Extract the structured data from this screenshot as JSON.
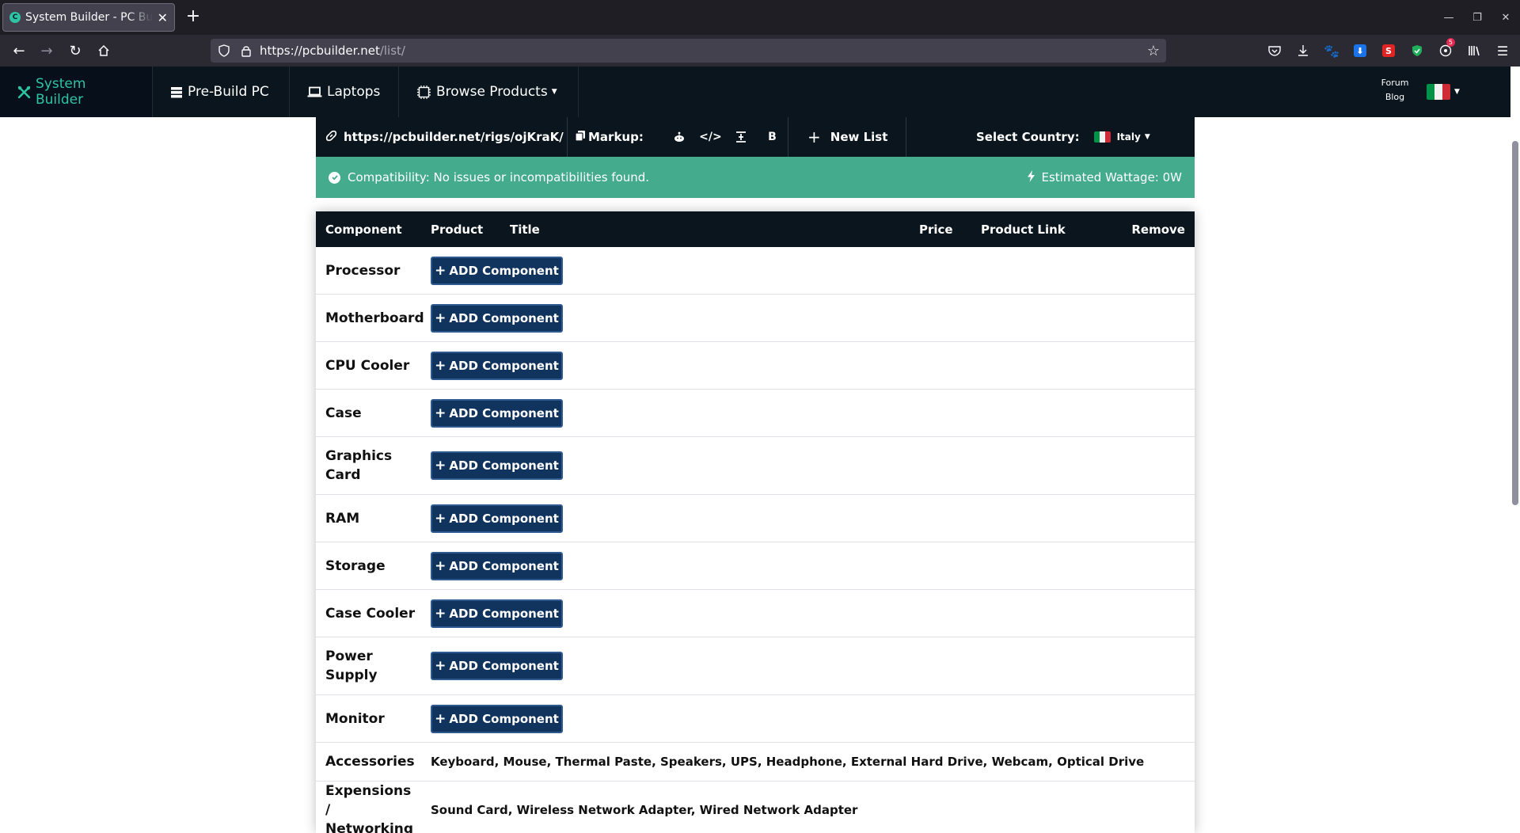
{
  "browser": {
    "tab_title": "System Builder - PC Builder",
    "tab_favicon": "C",
    "url_host": "https://pcbuilder.net",
    "url_path": "/list/",
    "notification_count": "5"
  },
  "site_nav": {
    "items": [
      {
        "label": "System Builder",
        "icon": "tools-icon"
      },
      {
        "label": "Pre-Build PC",
        "icon": "server-icon"
      },
      {
        "label": "Laptops",
        "icon": "laptop-icon"
      },
      {
        "label": "Browse Products",
        "icon": "chip-icon"
      }
    ],
    "forum_label": "Forum",
    "blog_label": "Blog"
  },
  "list_toolbar": {
    "share_link": "https://pcbuilder.net/rigs/ojKraK/",
    "markup_label": "Markup:",
    "new_list_label": "New List",
    "country_label": "Select Country:",
    "country_value": "Italy"
  },
  "compat": {
    "message": "Compatibility: No issues or incompatibilities found.",
    "wattage": "Estimated Wattage: 0W"
  },
  "table": {
    "headers": {
      "component": "Component",
      "product": "Product",
      "title": "Title",
      "price": "Price",
      "product_link": "Product Link",
      "remove": "Remove"
    },
    "add_button_label": "ADD Component",
    "rows": [
      {
        "label": "Processor"
      },
      {
        "label": "Motherboard"
      },
      {
        "label": "CPU Cooler"
      },
      {
        "label": "Case"
      },
      {
        "label": "Graphics Card"
      },
      {
        "label": "RAM"
      },
      {
        "label": "Storage"
      },
      {
        "label": "Case Cooler"
      },
      {
        "label": "Power Supply"
      },
      {
        "label": "Monitor"
      }
    ],
    "accessories_label": "Accessories",
    "accessories": [
      "Keyboard",
      "Mouse",
      "Thermal Paste",
      "Speakers",
      "UPS",
      "Headphone",
      "External Hard Drive",
      "Webcam",
      "Optical Drive"
    ],
    "expansions_label": "Expensions / Networking",
    "expansions": [
      "Sound Card",
      "Wireless Network Adapter",
      "Wired Network Adapter"
    ]
  },
  "colors": {
    "nav_bg": "#0a151d",
    "accent": "#2ec4a3",
    "compat_bg": "#44ab8d",
    "button_bg": "#11345f"
  }
}
